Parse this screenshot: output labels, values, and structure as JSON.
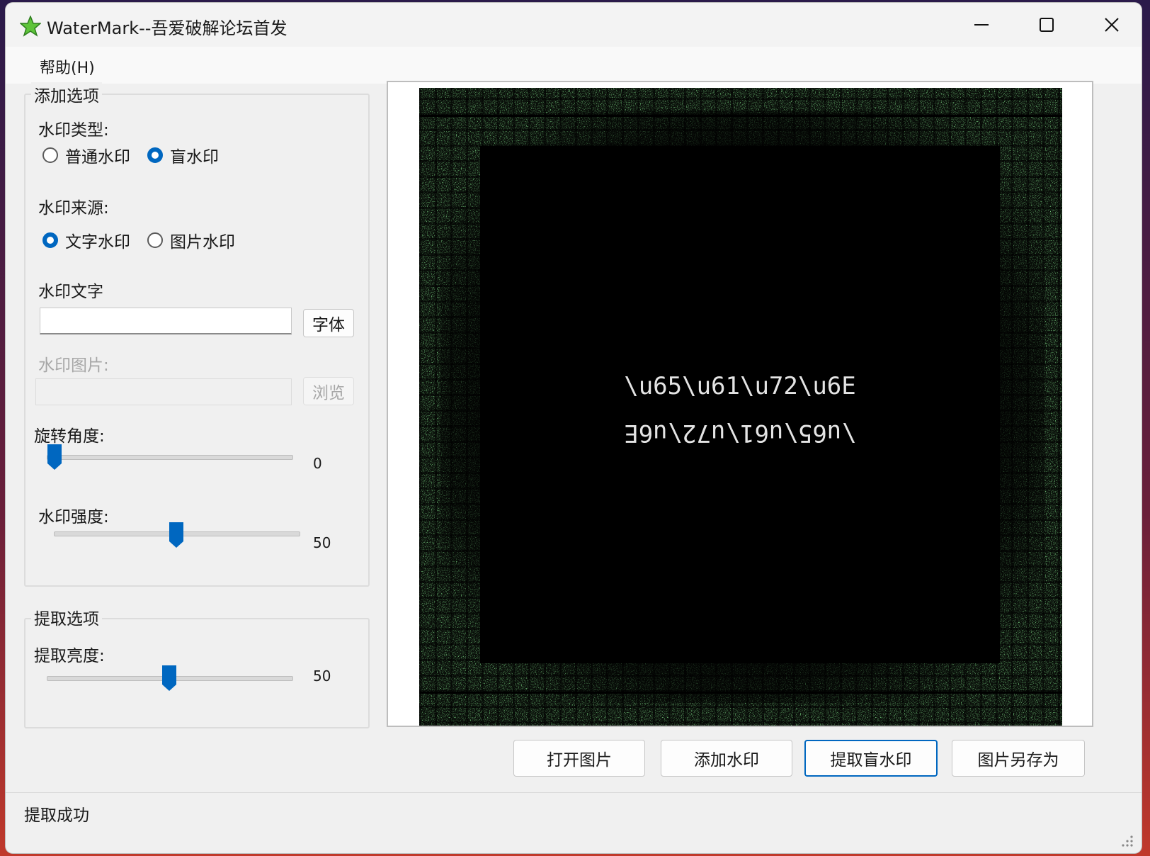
{
  "window": {
    "title": "WaterMark--吾爱破解论坛首发",
    "controls": [
      "minimize",
      "maximize",
      "close"
    ]
  },
  "menu": {
    "help": "帮助(H)"
  },
  "add_options": {
    "legend": "添加选项",
    "type_label": "水印类型:",
    "type_options": [
      {
        "label": "普通水印",
        "selected": false
      },
      {
        "label": "盲水印",
        "selected": true
      }
    ],
    "source_label": "水印来源:",
    "source_options": [
      {
        "label": "文字水印",
        "selected": true
      },
      {
        "label": "图片水印",
        "selected": false
      }
    ],
    "text_label": "水印文字",
    "text_value": "",
    "font_button": "字体",
    "image_label": "水印图片:",
    "image_value": "",
    "browse_button": "浏览",
    "rotation_label": "旋转角度:",
    "rotation_value": "0",
    "rotation_fraction": 0.0,
    "strength_label": "水印强度:",
    "strength_value": "50",
    "strength_fraction": 0.5
  },
  "extract_options": {
    "legend": "提取选项",
    "brightness_label": "提取亮度:",
    "brightness_value": "50",
    "brightness_fraction": 0.5
  },
  "preview": {
    "line1": "\\u65\\u61\\u72\\u6E",
    "line2": "\\u65\\u61\\u72\\u6E"
  },
  "buttons": {
    "open": "打开图片",
    "add": "添加水印",
    "extract": "提取盲水印",
    "save_as": "图片另存为"
  },
  "status": {
    "text": "提取成功"
  },
  "colors": {
    "accent": "#0067c0",
    "noise_green": "#3cd048",
    "preview_bg": "#000000"
  }
}
